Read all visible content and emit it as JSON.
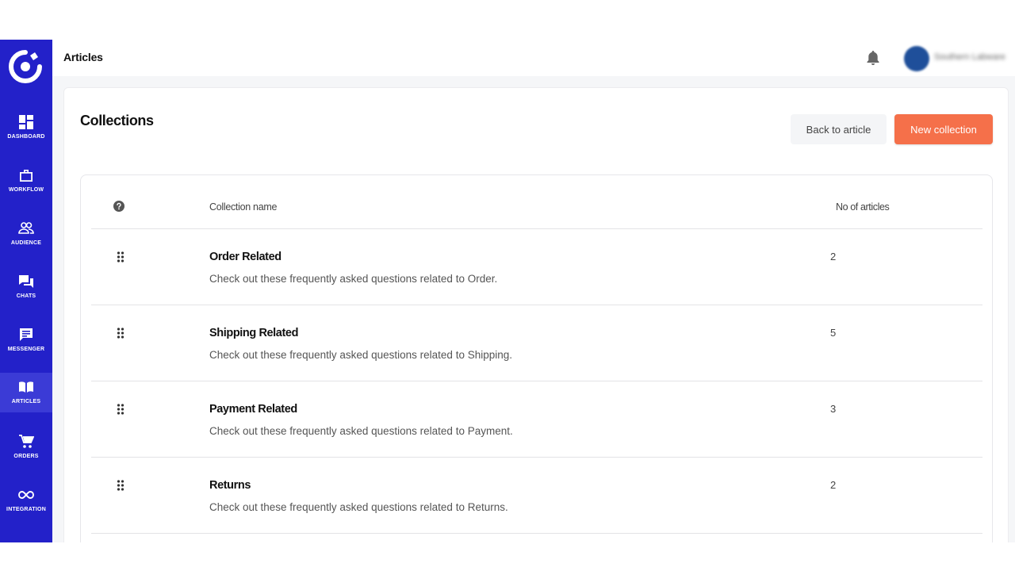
{
  "topbar": {
    "title": "Articles",
    "user_name": "Southern Labware"
  },
  "sidebar": {
    "items": [
      {
        "label": "DASHBOARD",
        "icon": "dashboard-icon"
      },
      {
        "label": "WORKFLOW",
        "icon": "briefcase-icon"
      },
      {
        "label": "AUDIENCE",
        "icon": "people-icon"
      },
      {
        "label": "CHATS",
        "icon": "chat-bubbles-icon"
      },
      {
        "label": "MESSENGER",
        "icon": "message-icon"
      },
      {
        "label": "ARTICLES",
        "icon": "book-icon",
        "active": true
      },
      {
        "label": "ORDERS",
        "icon": "cart-icon"
      },
      {
        "label": "INTEGRATION",
        "icon": "infinity-icon"
      }
    ]
  },
  "main": {
    "title": "Collections",
    "back_label": "Back to article",
    "new_label": "New collection",
    "table": {
      "col_name": "Collection name",
      "col_count": "No of articles",
      "rows": [
        {
          "title": "Order Related",
          "desc": "Check out these frequently asked questions related to Order.",
          "count": "2"
        },
        {
          "title": "Shipping Related",
          "desc": "Check out these frequently asked questions related to Shipping.",
          "count": "5"
        },
        {
          "title": "Payment Related",
          "desc": "Check out these frequently asked questions related to Payment.",
          "count": "3"
        },
        {
          "title": "Returns",
          "desc": "Check out these frequently asked questions related to Returns.",
          "count": "2"
        }
      ]
    }
  },
  "colors": {
    "sidebar": "#2321c9",
    "sidebar_active": "#3b3bd6",
    "accent": "#f5704a"
  }
}
